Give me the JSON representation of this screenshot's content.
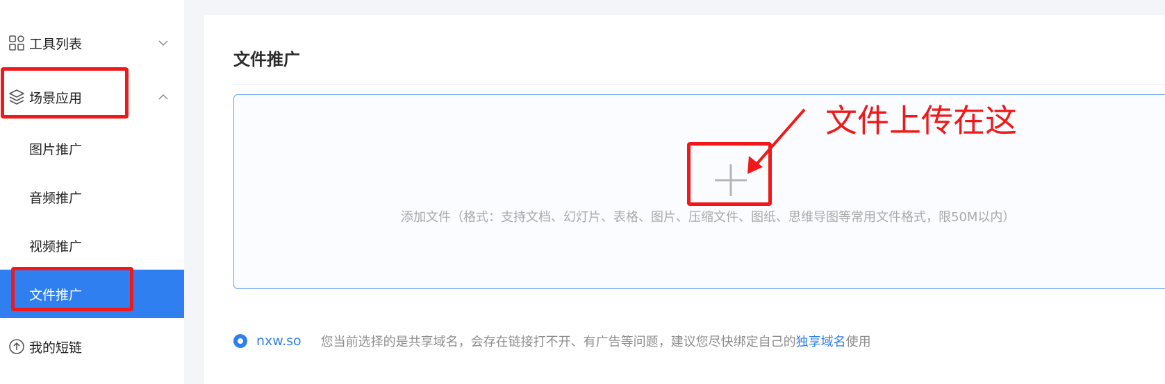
{
  "sidebar": {
    "groups": [
      {
        "label": "工具列表",
        "icon": "grid-icon",
        "state": "collapsed"
      },
      {
        "label": "场景应用",
        "icon": "layers-icon",
        "state": "expanded"
      },
      {
        "label": "我的短链",
        "icon": "link-circle-icon"
      }
    ],
    "sub_items": [
      {
        "label": "图片推广",
        "active": false
      },
      {
        "label": "音频推广",
        "active": false
      },
      {
        "label": "视频推广",
        "active": false
      },
      {
        "label": "文件推广",
        "active": true
      }
    ],
    "active_color": "#2f7ff0"
  },
  "main": {
    "title": "文件推广",
    "upload": {
      "icon": "plus-icon",
      "hint": "添加文件（格式：支持文档、幻灯片、表格、图片、压缩文件、图纸、思维导图等常用文件格式，限50M以内）"
    },
    "domain": {
      "selected": true,
      "name": "nxw.so",
      "notice_prefix": "您当前选择的是共享域名，会存在链接打不开、有广告等问题，建议您尽快绑定自己的",
      "notice_link": "独享域名",
      "notice_suffix": "使用"
    }
  },
  "annotation": {
    "text": "文件上传在这",
    "color": "#f01818"
  }
}
